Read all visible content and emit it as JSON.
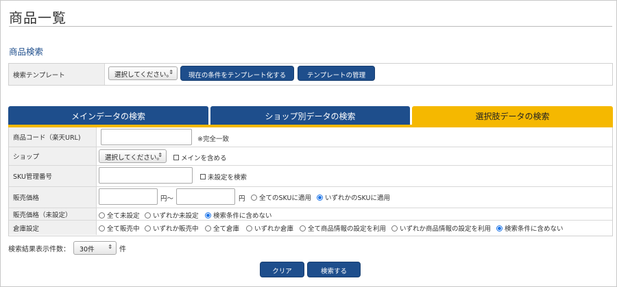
{
  "page": {
    "title": "商品一覧",
    "section_title": "商品検索"
  },
  "template": {
    "label": "検索テンプレート",
    "select_value": "選択してください。",
    "create_button": "現在の条件をテンプレート化する",
    "manage_button": "テンプレートの管理"
  },
  "tabs": [
    {
      "label": "メインデータの検索",
      "active": false
    },
    {
      "label": "ショップ別データの検索",
      "active": false
    },
    {
      "label": "選択肢データの検索",
      "active": true
    }
  ],
  "form": {
    "product_code": {
      "label": "商品コード（楽天URL)",
      "value": "",
      "note": "※完全一致"
    },
    "shop": {
      "label": "ショップ",
      "select_value": "選択してください。",
      "checkbox_label": "メインを含める"
    },
    "sku": {
      "label": "SKU管理番号",
      "value": "",
      "checkbox_label": "未設定を検索"
    },
    "price": {
      "label": "販売価格",
      "from": "",
      "to": "",
      "unit_from": "円～",
      "unit_to": "円",
      "options": [
        {
          "label": "全てのSKUに適用",
          "checked": false
        },
        {
          "label": "いずれかのSKUに適用",
          "checked": true
        }
      ]
    },
    "price_unset": {
      "label": "販売価格（未設定）",
      "options": [
        {
          "label": "全て未設定",
          "checked": false
        },
        {
          "label": "いずれか未設定",
          "checked": false
        },
        {
          "label": "検索条件に含めない",
          "checked": true
        }
      ]
    },
    "warehouse": {
      "label": "倉庫設定",
      "options": [
        {
          "label": "全て販売中",
          "checked": false
        },
        {
          "label": "いずれか販売中",
          "checked": false
        },
        {
          "label": "全て倉庫",
          "checked": false
        },
        {
          "label": "いずれか倉庫",
          "checked": false
        },
        {
          "label": "全て商品情報の設定を利用",
          "checked": false
        },
        {
          "label": "いずれか商品情報の設定を利用",
          "checked": false
        },
        {
          "label": "検索条件に含めない",
          "checked": true
        }
      ]
    }
  },
  "results": {
    "label": "検索結果表示件数：",
    "select_value": "30件",
    "unit": "件"
  },
  "buttons": {
    "clear": "クリア",
    "search": "検索する"
  },
  "colors": {
    "navy": "#1e4e8c",
    "active_tab": "#f5b800",
    "label_bg": "#f0f0f0"
  }
}
